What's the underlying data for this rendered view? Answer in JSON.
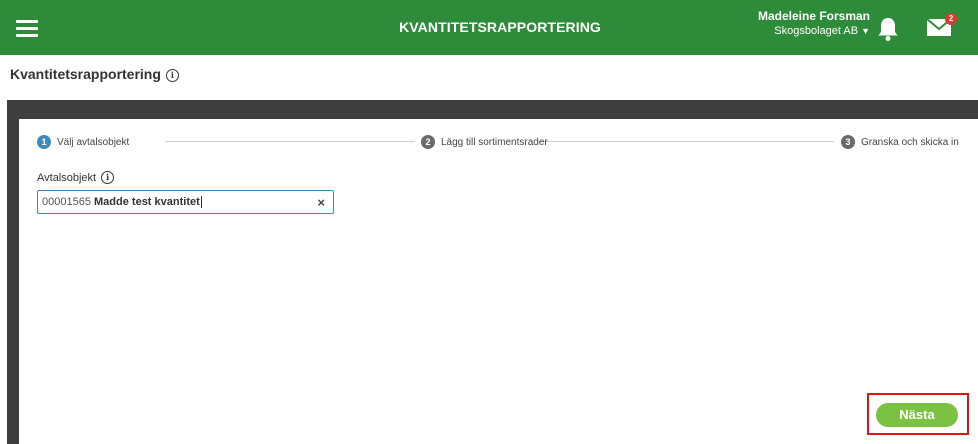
{
  "header": {
    "app_title": "KVANTITETSRAPPORTERING",
    "user_name": "Madeleine Forsman",
    "organization": "Skogsbolaget AB",
    "mail_count": "2"
  },
  "page": {
    "title": "Kvantitetsrapportering",
    "info_glyph": "i"
  },
  "stepper": {
    "steps": [
      {
        "number": "1",
        "label": "Välj avtalsobjekt",
        "state": "active"
      },
      {
        "number": "2",
        "label": "Lägg till sortimentsrader",
        "state": "inactive"
      },
      {
        "number": "3",
        "label": "Granska och skicka in",
        "state": "inactive"
      }
    ]
  },
  "form": {
    "field_label": "Avtalsobjekt",
    "value_number": "00001565",
    "value_name": "Madde test kvantitet",
    "clear_glyph": "×"
  },
  "actions": {
    "next_label": "Nästa"
  },
  "colors": {
    "header_bg": "#2e8b3a",
    "step_active": "#3c8cbf",
    "next_button": "#7cc242",
    "highlight": "#e11212"
  }
}
